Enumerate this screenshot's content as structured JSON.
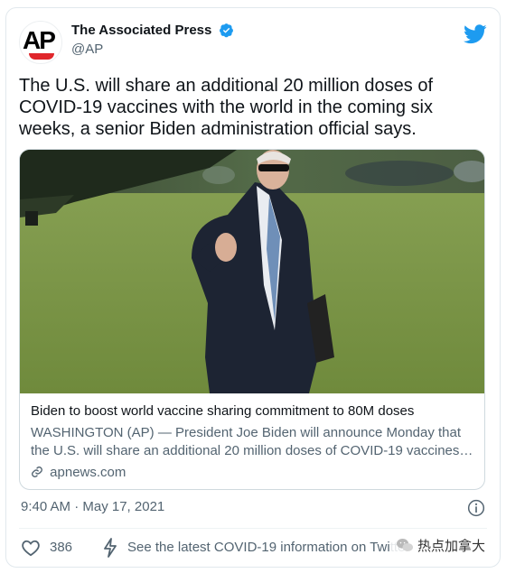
{
  "account": {
    "name": "The Associated Press",
    "handle": "@AP",
    "avatar_text": "AP"
  },
  "tweet": {
    "text": "The U.S. will share an additional 20 million doses of COVID-19 vaccines with the world in the coming six weeks, a senior Biden administration official says.",
    "timestamp": "9:40 AM · May 17, 2021"
  },
  "link_card": {
    "title": "Biden to boost world vaccine sharing commitment to 80M doses",
    "description_line1": "WASHINGTON (AP) — President Joe Biden will announce Monday that",
    "description_line2": "the U.S. will share an additional 20 million doses of COVID-19 vaccines…",
    "domain": "apnews.com"
  },
  "footer": {
    "like_count": "386",
    "covid_link": "See the latest COVID-19 information on Twitter"
  },
  "watermark": {
    "text": "热点加拿大"
  },
  "colors": {
    "twitter_blue": "#1d9bf0",
    "text_primary": "#0f1419",
    "text_secondary": "#536471",
    "border": "#cfd9de",
    "ap_red": "#e0262b"
  }
}
